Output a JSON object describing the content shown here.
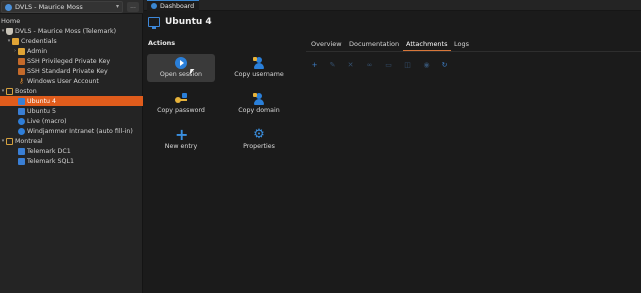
{
  "vault": {
    "name": "DVLS - Maurice Moss",
    "more": "..."
  },
  "home_label": "Home",
  "tree": [
    {
      "label": "DVLS - Maurice Moss (Telemark)",
      "indent": 0,
      "twisty": "▾",
      "icon": "db"
    },
    {
      "label": "Credentials",
      "indent": 1,
      "twisty": "▾",
      "icon": "folder"
    },
    {
      "label": "Admin",
      "indent": 2,
      "twisty": "›",
      "icon": "folder"
    },
    {
      "label": "SSH Privileged Private Key",
      "indent": 2,
      "twisty": "",
      "icon": "keyfile"
    },
    {
      "label": "SSH Standard Private Key",
      "indent": 2,
      "twisty": "",
      "icon": "keyfile"
    },
    {
      "label": "Windows User Account",
      "indent": 2,
      "twisty": "",
      "icon": "key"
    },
    {
      "label": "Boston",
      "indent": 0,
      "twisty": "▾",
      "icon": "folder-o"
    },
    {
      "label": "Ubuntu 4",
      "indent": 2,
      "twisty": "",
      "icon": "monitor",
      "selected": true
    },
    {
      "label": "Ubuntu 5",
      "indent": 2,
      "twisty": "",
      "icon": "monitor"
    },
    {
      "label": "Live (macro)",
      "indent": 2,
      "twisty": "",
      "icon": "blue"
    },
    {
      "label": "Windjammer Intranet (auto fill-in)",
      "indent": 2,
      "twisty": "",
      "icon": "blue"
    },
    {
      "label": "Montreal",
      "indent": 0,
      "twisty": "▾",
      "icon": "folder-o"
    },
    {
      "label": "Telemark DC1",
      "indent": 2,
      "twisty": "",
      "icon": "monitor"
    },
    {
      "label": "Telemark SQL1",
      "indent": 2,
      "twisty": "",
      "icon": "monitor"
    }
  ],
  "top_tab": {
    "label": "Dashboard"
  },
  "entry": {
    "title": "Ubuntu 4"
  },
  "actions": {
    "heading": "Actions",
    "open_session": "Open session",
    "copy_username": "Copy username",
    "copy_password": "Copy password",
    "copy_domain": "Copy domain",
    "new_entry": "New entry",
    "properties": "Properties"
  },
  "detail_tabs": [
    "Overview",
    "Documentation",
    "Attachments",
    "Logs"
  ],
  "active_detail_tab": "Attachments",
  "toolbar_icons": [
    "add-icon",
    "edit-icon",
    "delete-icon",
    "link-icon",
    "save-icon",
    "open-icon",
    "view-icon",
    "settings-icon",
    "refresh-icon"
  ],
  "colors": {
    "accent": "#e05c1c",
    "blue": "#2a7fd9",
    "tab_underline": "#d8773a"
  }
}
